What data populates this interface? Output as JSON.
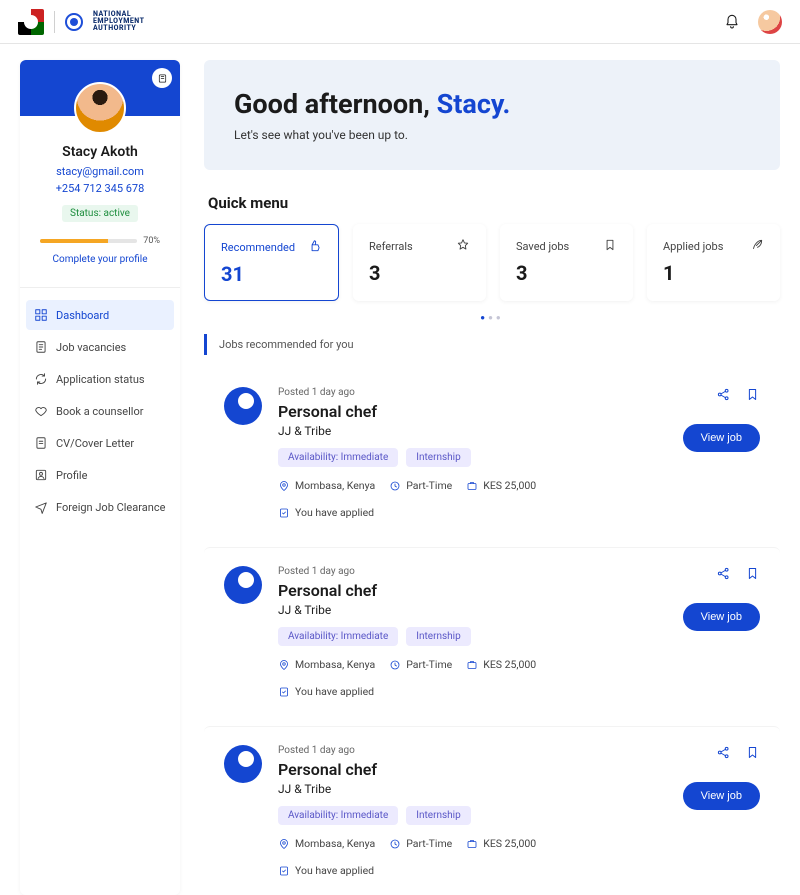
{
  "topbar": {
    "brand": "NATIONAL\nEMPLOYMENT\nAUTHORITY"
  },
  "profile": {
    "name": "Stacy Akoth",
    "email": "stacy@gmail.com",
    "phone": "+254 712 345 678",
    "status": "Status: active",
    "progress_pct": "70%",
    "complete_link": "Complete your profile"
  },
  "nav": {
    "items": [
      {
        "label": "Dashboard"
      },
      {
        "label": "Job vacancies"
      },
      {
        "label": "Application status"
      },
      {
        "label": "Book a counsellor"
      },
      {
        "label": "CV/Cover Letter"
      },
      {
        "label": "Profile"
      },
      {
        "label": "Foreign Job Clearance"
      }
    ]
  },
  "greeting": {
    "prefix": "Good afternoon, ",
    "name": "Stacy.",
    "sub": "Let's see what you've been up to."
  },
  "quick": {
    "title": "Quick menu",
    "cards": [
      {
        "label": "Recommended",
        "value": "31"
      },
      {
        "label": "Referrals",
        "value": "3"
      },
      {
        "label": "Saved jobs",
        "value": "3"
      },
      {
        "label": "Applied jobs",
        "value": "1"
      }
    ]
  },
  "section": {
    "recommended_label": "Jobs recommended for you"
  },
  "jobs": [
    {
      "posted": "Posted 1 day ago",
      "title": "Personal chef",
      "company": "JJ & Tribe",
      "tag1": "Availability: Immediate",
      "tag2": "Internship",
      "loc": "Mombasa, Kenya",
      "type": "Part-Time",
      "salary": "KES 25,000",
      "applied": "You have applied",
      "view": "View job"
    },
    {
      "posted": "Posted 1 day ago",
      "title": "Personal chef",
      "company": "JJ & Tribe",
      "tag1": "Availability: Immediate",
      "tag2": "Internship",
      "loc": "Mombasa, Kenya",
      "type": "Part-Time",
      "salary": "KES 25,000",
      "applied": "You have applied",
      "view": "View job"
    },
    {
      "posted": "Posted 1 day ago",
      "title": "Personal chef",
      "company": "JJ & Tribe",
      "tag1": "Availability: Immediate",
      "tag2": "Internship",
      "loc": "Mombasa, Kenya",
      "type": "Part-Time",
      "salary": "KES 25,000",
      "applied": "You have applied",
      "view": "View job"
    }
  ]
}
